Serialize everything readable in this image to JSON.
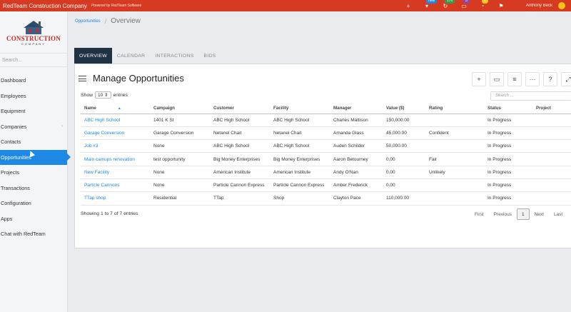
{
  "topbar": {
    "company": "RedTeam Construction Company",
    "powered": "Powered by RedTeam Software",
    "icons": [
      {
        "name": "plus-icon",
        "glyph": "+",
        "badge": "",
        "color": ""
      },
      {
        "name": "filter-icon",
        "glyph": "▾",
        "badge": "new",
        "color": "#1e88e5"
      },
      {
        "name": "refresh-icon",
        "glyph": "↻",
        "badge": "170",
        "color": "#2e9e48"
      },
      {
        "name": "chat-icon",
        "glyph": "▭",
        "badge": "3",
        "color": "#8e44ad"
      },
      {
        "name": "bell-icon",
        "glyph": "◔",
        "badge": "0",
        "color": "#f0c419"
      },
      {
        "name": "flag-icon",
        "glyph": "⚑",
        "badge": "",
        "color": ""
      }
    ],
    "user_name": "Anthony Beck"
  },
  "logo": {
    "wordmark": "CONSTRUCTION",
    "sub": "COMPANY"
  },
  "sidebar": {
    "search_placeholder": "Search...",
    "items": [
      {
        "label": "Dashboard",
        "name": "dashboard",
        "chev": "",
        "active": false
      },
      {
        "label": "Employees",
        "name": "employees",
        "chev": "",
        "active": false
      },
      {
        "label": "Equipment",
        "name": "equipment",
        "chev": "",
        "active": false
      },
      {
        "label": "Companies",
        "name": "companies",
        "chev": "›",
        "active": false
      },
      {
        "label": "Contacts",
        "name": "contacts",
        "chev": "",
        "active": false
      },
      {
        "label": "Opportunities",
        "name": "opportunities",
        "chev": "",
        "active": true
      },
      {
        "label": "Projects",
        "name": "projects",
        "chev": "",
        "active": false
      },
      {
        "label": "Transactions",
        "name": "transactions",
        "chev": "",
        "active": false
      },
      {
        "label": "Configuration",
        "name": "configuration",
        "chev": "",
        "active": false
      },
      {
        "label": "Apps",
        "name": "apps",
        "chev": "",
        "active": false
      },
      {
        "label": "Chat with RedTeam",
        "name": "chat-with-redteam",
        "chev": "",
        "active": false
      }
    ]
  },
  "breadcrumb": {
    "parent": "Opportunities",
    "current": "Overview"
  },
  "tabs": [
    {
      "label": "OVERVIEW",
      "active": true
    },
    {
      "label": "CALENDAR",
      "active": false
    },
    {
      "label": "INTERACTIONS",
      "active": false
    },
    {
      "label": "BIDS",
      "active": false
    }
  ],
  "card": {
    "title": "Manage Opportunities",
    "toolbar": [
      {
        "name": "add-button",
        "glyph": "+"
      },
      {
        "name": "display-button",
        "glyph": "▭"
      },
      {
        "name": "filter-button",
        "glyph": "≡"
      },
      {
        "name": "more-button",
        "glyph": "···"
      },
      {
        "name": "help-button",
        "glyph": "?"
      },
      {
        "name": "expand-button",
        "glyph": "⤢"
      }
    ]
  },
  "table_controls": {
    "show_label": "Show",
    "show_value": "10",
    "entries_label": "entries",
    "search_placeholder": "Search ..."
  },
  "table": {
    "columns": [
      "Name",
      "Campaign",
      "Customer",
      "Facility",
      "Manager",
      "Value ($)",
      "Rating",
      "Status",
      "Project"
    ],
    "rows": [
      [
        "ABC High School",
        "1401 K St",
        "ABC High School",
        "ABC High School",
        "Charles Mattison",
        "150,000.00",
        "",
        "In Progress",
        ""
      ],
      [
        "Garage Conversion",
        "Garage Conversion",
        "Netanel Chait",
        "Netanel Chait",
        "Amanda Glass",
        "45,000.00",
        "Confident",
        "In Progress",
        ""
      ],
      [
        "Job #3",
        "None",
        "ABC High School",
        "ABC High School",
        "Auden Schilder",
        "50,000.00",
        "",
        "In Progress",
        ""
      ],
      [
        "Main camups renovation",
        "test opportunity",
        "Big Money Enterprises",
        "Big Money Enterprises",
        "Aaron Betourney",
        "0.00",
        "Fair",
        "In Progress",
        ""
      ],
      [
        "New Facility",
        "None",
        "American Institute",
        "American Institute",
        "Andy O'Nan",
        "0.00",
        "Unlikely",
        "In Progress",
        ""
      ],
      [
        "Particle Cannons",
        "None",
        "Particle Cannon Express",
        "Particle Cannon Express",
        "Amber Frederick",
        "0.00",
        "",
        "In Progress",
        ""
      ],
      [
        "TTap shop",
        "Residential",
        "TTap",
        "Shop",
        "Clayton Pace",
        "110,000.00",
        "",
        "In Progress",
        ""
      ]
    ]
  },
  "footer": {
    "info": "Showing 1 to 7 of 7 entries",
    "pager": {
      "first": "First",
      "previous": "Previous",
      "current": "1",
      "next": "Next",
      "last": "Last"
    }
  }
}
